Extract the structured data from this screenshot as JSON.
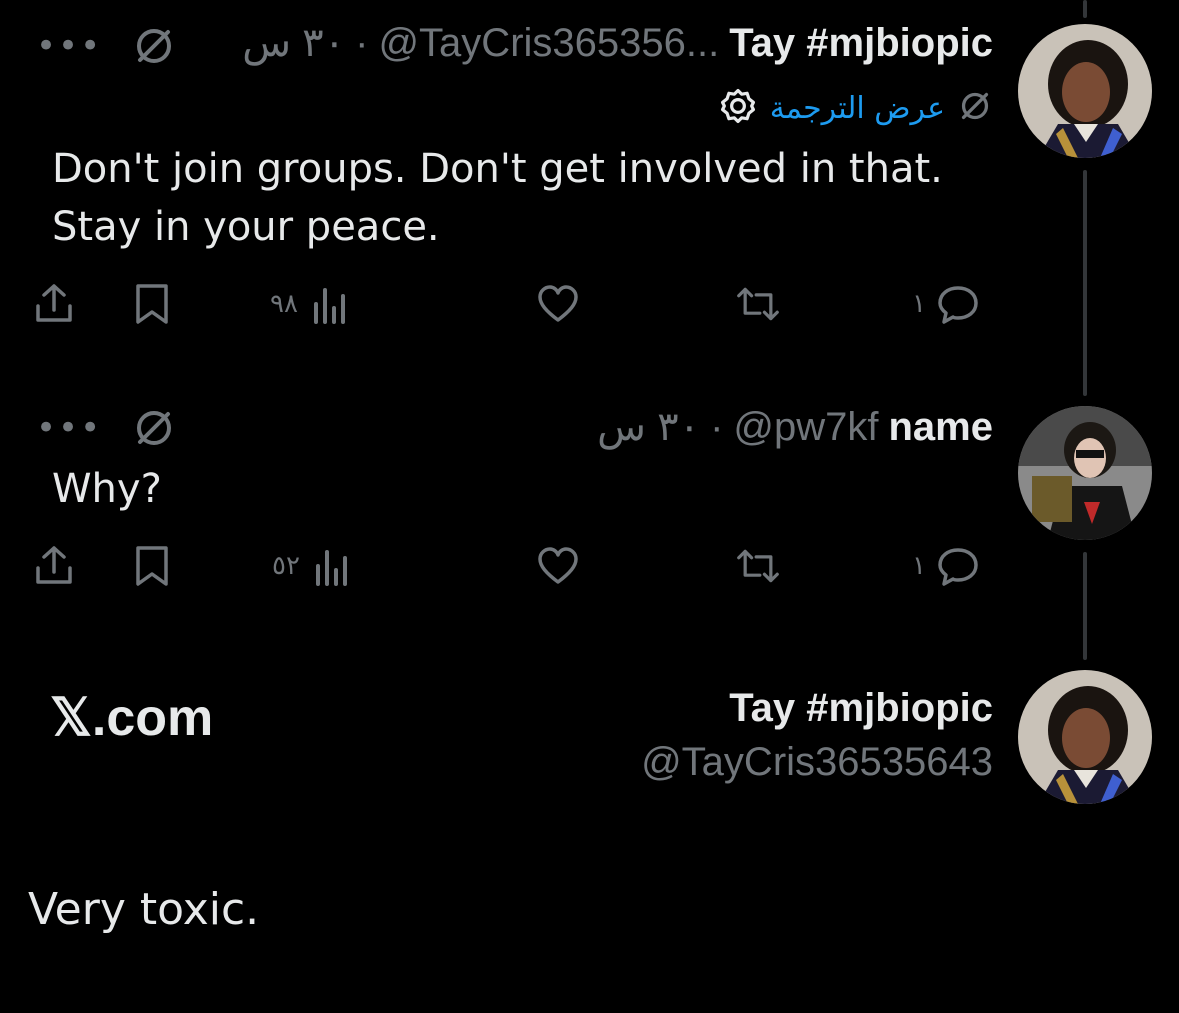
{
  "tweet1": {
    "display_name": "Tay #mjbiopic",
    "handle": "@TayCris365356...",
    "dot": "·",
    "time": "٣٠ س",
    "translate_label": "عرض الترجمة",
    "text_line1": "Don't join groups. Don't get involved in that.",
    "text_line2": "Stay in your peace.",
    "views": "٩٨",
    "replies": "١",
    "more_label": "•••"
  },
  "tweet2": {
    "display_name": "name",
    "handle": "@pw7kf",
    "dot": "·",
    "time": "٣٠ س",
    "text": "Why?",
    "views": "٥٢",
    "replies": "١",
    "more_label": "•••"
  },
  "embed": {
    "site": "𝕏.com",
    "display_name": "Tay #mjbiopic",
    "handle": "@TayCris36535643",
    "text": "Very toxic."
  },
  "icons": {
    "share": "share-icon",
    "bookmark": "bookmark-icon",
    "views": "views-chart-icon",
    "like": "heart-icon",
    "retweet": "retweet-icon",
    "reply": "reply-bubble-icon",
    "more": "more-dots-icon",
    "grok": "no-entry-icon",
    "settings": "gear-icon"
  },
  "colors": {
    "background": "#000000",
    "text": "#e7e9ea",
    "muted": "#71767b",
    "link": "#1d9bf0",
    "thread_line": "#333639"
  }
}
